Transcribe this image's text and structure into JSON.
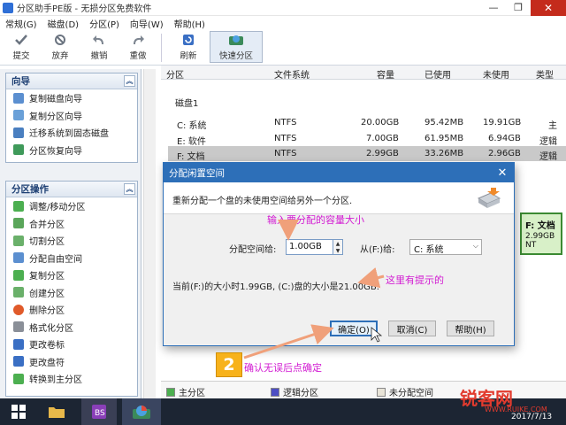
{
  "window": {
    "title": "分区助手PE版 - 无损分区免费软件",
    "minimize": "—",
    "restore": "❐",
    "close": "✕"
  },
  "menu": [
    "常规(G)",
    "磁盘(D)",
    "分区(P)",
    "向导(W)",
    "帮助(H)"
  ],
  "toolbar": {
    "items": [
      "提交",
      "放弃",
      "撤销",
      "重做",
      "刷新",
      "快速分区"
    ]
  },
  "sidebar": {
    "wizard": {
      "title": "向导",
      "items": [
        "复制磁盘向导",
        "复制分区向导",
        "迁移系统到固态磁盘",
        "分区恢复向导"
      ]
    },
    "ops": {
      "title": "分区操作",
      "items": [
        "调整/移动分区",
        "合并分区",
        "切割分区",
        "分配自由空间",
        "复制分区",
        "创建分区",
        "删除分区",
        "格式化分区",
        "更改卷标",
        "更改盘符",
        "转换到主分区"
      ]
    }
  },
  "table": {
    "headers": [
      "分区",
      "文件系统",
      "容量",
      "已使用",
      "未使用",
      "类型"
    ],
    "disk_label": "磁盘1",
    "rows": [
      [
        "C: 系统",
        "NTFS",
        "20.00GB",
        "95.42MB",
        "19.91GB",
        "主"
      ],
      [
        "E: 软件",
        "NTFS",
        "7.00GB",
        "61.95MB",
        "6.94GB",
        "逻辑"
      ],
      [
        "F: 文档",
        "NTFS",
        "2.99GB",
        "33.26MB",
        "2.96GB",
        "逻辑"
      ]
    ],
    "selected_row": 2
  },
  "diskmap": {
    "label": "F: 文档",
    "size": "2.99GB NT"
  },
  "dialog": {
    "title": "分配闲置空间",
    "close": "✕",
    "description": "重新分配一个盘的未使用空间给另外一个分区.",
    "space_label": "分配空间给:",
    "space_value": "1.00GB",
    "from_label": "从(F:)给:",
    "target_value": "C: 系统",
    "status_text": "当前(F:)的大小时1.99GB, (C:)盘的大小是21.00GB.",
    "ok": "确定(O)",
    "cancel": "取消(C)",
    "help": "帮助(H)"
  },
  "annotations": {
    "a1": "输入要分配的容量大小",
    "a2": "这里有提示的",
    "a3": "确认无误后点确定",
    "badge": "2"
  },
  "legend": [
    "主分区",
    "逻辑分区",
    "未分配空间"
  ],
  "colors": {
    "accent": "#2d6fb8",
    "annotation": "#d21bd2",
    "arrow": "#f0a07a",
    "primary_swatch": "#4caf50",
    "logical_swatch": "#4d4fc4",
    "unalloc_swatch": "#e8e4d8"
  },
  "watermark": {
    "main": "锐客网",
    "sub": "WWW.RUIKE.COM"
  },
  "taskbar": {
    "date": "2017/7/13"
  }
}
